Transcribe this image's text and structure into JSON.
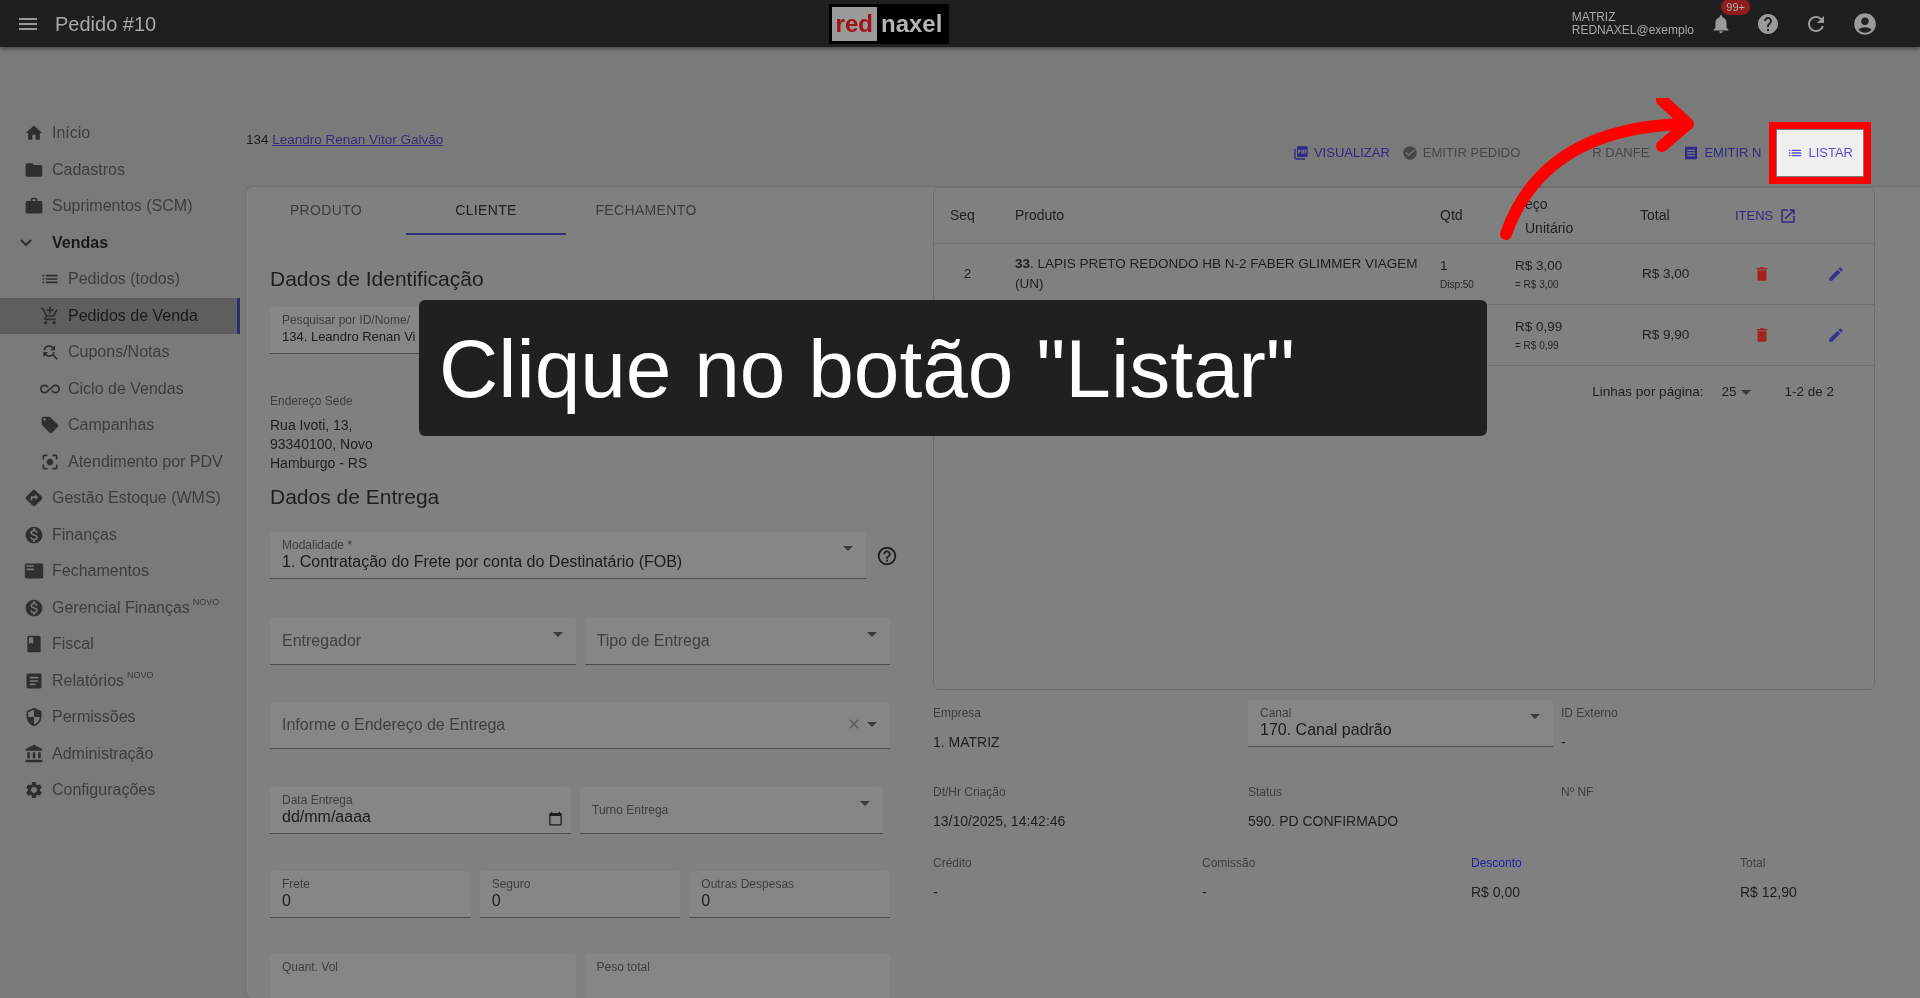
{
  "header": {
    "title": "Pedido #10",
    "logo": {
      "part_1": "red",
      "part_2": "naxel"
    },
    "account": {
      "line_1": "MATRIZ",
      "line_2": "REDNAXEL@exemplo"
    },
    "notifications": "99+"
  },
  "sidebar": {
    "items": [
      {
        "label": "Início",
        "selected": false
      },
      {
        "label": "Cadastros",
        "selected": false
      },
      {
        "label": "Suprimentos (SCM)",
        "selected": false
      },
      {
        "label": "Vendas",
        "selected": false,
        "expanded": true,
        "children": [
          {
            "label": "Pedidos (todos)",
            "selected": false
          },
          {
            "label": "Pedidos de Venda",
            "selected": true
          },
          {
            "label": "Cupons/Notas",
            "selected": false
          },
          {
            "label": "Ciclo de Vendas",
            "selected": false
          },
          {
            "label": "Campanhas",
            "selected": false
          },
          {
            "label": "Atendimento por PDV",
            "selected": false
          }
        ]
      },
      {
        "label": "Gestão Estoque (WMS)",
        "selected": false
      },
      {
        "label": "Finanças",
        "selected": false
      },
      {
        "label": "Fechamentos",
        "selected": false
      },
      {
        "label": "Gerencial Finanças",
        "badge": "NOVO",
        "selected": false
      },
      {
        "label": "Fiscal",
        "selected": false
      },
      {
        "label": "Relatórios",
        "badge": "NOVO",
        "selected": false
      },
      {
        "label": "Permissões",
        "selected": false
      },
      {
        "label": "Administração",
        "selected": false
      },
      {
        "label": "Configurações",
        "selected": false
      }
    ]
  },
  "customer": {
    "id": "134",
    "name": "Leandro Renan Vitor Galvão"
  },
  "actions": [
    {
      "label": "VISUALIZAR",
      "disabled": false,
      "spotlight": false
    },
    {
      "label": "EMITIR PEDIDO",
      "disabled": true,
      "spotlight": false
    },
    {
      "label": "R DANFE",
      "disabled": true,
      "spotlight": false
    },
    {
      "label": "EMITIR N",
      "disabled": false,
      "spotlight": false
    },
    {
      "label": "LISTAR",
      "disabled": false,
      "spotlight": true
    }
  ],
  "tabs": [
    {
      "label": "PRODUTO",
      "selected": false
    },
    {
      "label": "CLIENTE",
      "selected": true
    },
    {
      "label": "FECHAMENTO",
      "selected": false
    }
  ],
  "identification": {
    "heading": "Dados de Identificação",
    "search": {
      "label": "Pesquisar por ID/Nome/",
      "value": "134. Leandro Renan Vi"
    },
    "address": {
      "label": "Endereço Sede",
      "value": "Rua Ivoti, 13, 93340100, Novo Hamburgo - RS"
    }
  },
  "delivery": {
    "heading": "Dados de Entrega",
    "modalidade": {
      "label": "Modalidade *",
      "value": "1. Contratação do Frete por conta do Destinatário (FOB)"
    },
    "entregador": {
      "placeholder": "Entregador"
    },
    "tipo": {
      "placeholder": "Tipo de Entrega"
    },
    "endereco": {
      "placeholder": "Informe o Endereço de Entrega"
    },
    "data": {
      "label": "Data Entrega",
      "value": "dd/mm/aaaa"
    },
    "turno": {
      "label": "Turno Entrega"
    },
    "costs": [
      {
        "label": "Frete",
        "value": "0"
      },
      {
        "label": "Seguro",
        "value": "0"
      },
      {
        "label": "Outras Despesas",
        "value": "0"
      }
    ],
    "volumes": [
      {
        "label": "Quant. Vol"
      },
      {
        "label": "Peso total"
      }
    ]
  },
  "table": {
    "columns": [
      "Seq",
      "Produto",
      "Qtd",
      "eço Unitário",
      "Total"
    ],
    "items_link": "ITENS",
    "rows": [
      {
        "seq": "2",
        "product": "**33**. LAPIS PRETO REDONDO HB N-2 FABER GLIMMER VIAGEM (UN)",
        "qty": "1",
        "stock": "Disp:50",
        "price": "R$ 3,00",
        "price_note": "= R$ 3,00",
        "total": "R$ 3,00"
      },
      {
        "price": "R$ 0,99",
        "price_note": "= R$ 0,99",
        "total": "R$ 9,90"
      }
    ],
    "pagination": {
      "label": "Linhas por página:",
      "value": "25",
      "range": "1-2 de 2"
    }
  },
  "summary": {
    "empresa": {
      "label": "Empresa",
      "value": "1. MATRIZ"
    },
    "canal": {
      "label": "Canal",
      "value": "170. Canal padrão"
    },
    "id_externo": {
      "label": "ID Externo",
      "value": "-"
    },
    "criacao": {
      "label": "Dt/Hr Criação",
      "value": "13/10/2025, 14:42:46"
    },
    "status": {
      "label": "Status",
      "value": "590. PD CONFIRMADO"
    },
    "nf": {
      "label": "Nº NF"
    },
    "totals": [
      {
        "label": "Crédito",
        "value": "-",
        "link": false
      },
      {
        "label": "Comissão",
        "value": "-",
        "link": false
      },
      {
        "label": "Desconto",
        "value": "R$ 0,00",
        "link": true
      },
      {
        "label": "Total",
        "value": "R$ 12,90",
        "link": false
      }
    ]
  },
  "tooltip": {
    "text": "Clique no botão \"Listar\""
  }
}
